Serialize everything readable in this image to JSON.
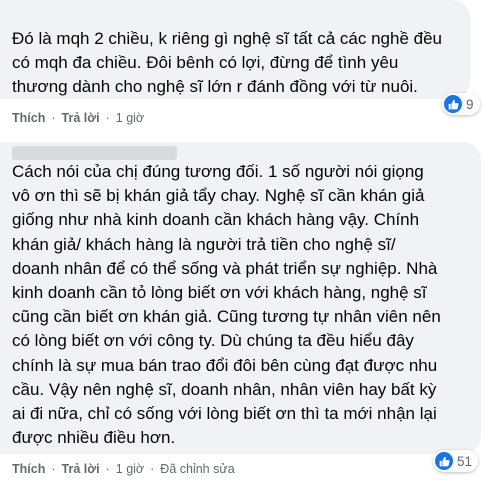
{
  "comments": [
    {
      "text": "Đó là mqh 2 chiều, k riêng gì nghệ sĩ tất cả các nghề đều\ncó mqh đa chiều. Đôi bênh có lợi, đừng để tình yêu\nthương dành cho nghệ sĩ lớn r đánh đồng với từ nuôi.",
      "reaction_count": "9",
      "actions": {
        "like": "Thích",
        "reply": "Trả lời",
        "time": "1 giờ"
      }
    },
    {
      "text": "Cách nói của chị đúng tương đối. 1 số người nói giọng\nvô ơn thì sẽ bị khán giả tẩy chay. Nghệ sĩ cần khán giả\ngiống như nhà kinh doanh cần khách hàng vậy. Chính\nkhán giả/ khách hàng là người trả tiền cho nghệ sĩ/\ndoanh nhân để có thể sống và phát triển sự nghiệp. Nhà\nkinh doanh cần tỏ lòng biết ơn với khách hàng, nghệ sĩ\ncũng cần biết ơn khán giả. Cũng tương tự nhân viên nên\ncó lòng biết ơn với công ty. Dù chúng ta đều hiểu đây\nchính là sự mua bán trao đổi đôi bên cùng đạt được nhu\ncầu. Vậy nên nghệ sĩ, doanh nhân, nhân viên hay bất kỳ\nai đi nữa, chỉ có sống với lòng biết ơn thì ta mới nhận lại\nđược nhiều điều hơn.",
      "reaction_count": "51",
      "actions": {
        "like": "Thích",
        "reply": "Trả lời",
        "time": "1 giờ",
        "edited": "Đã chỉnh sửa"
      }
    }
  ],
  "colors": {
    "bubble": "#f0f2f5",
    "like_blue": "#1b74e4",
    "meta_gray": "#65676b"
  },
  "icons": {
    "reaction": "thumbs-up-icon"
  }
}
